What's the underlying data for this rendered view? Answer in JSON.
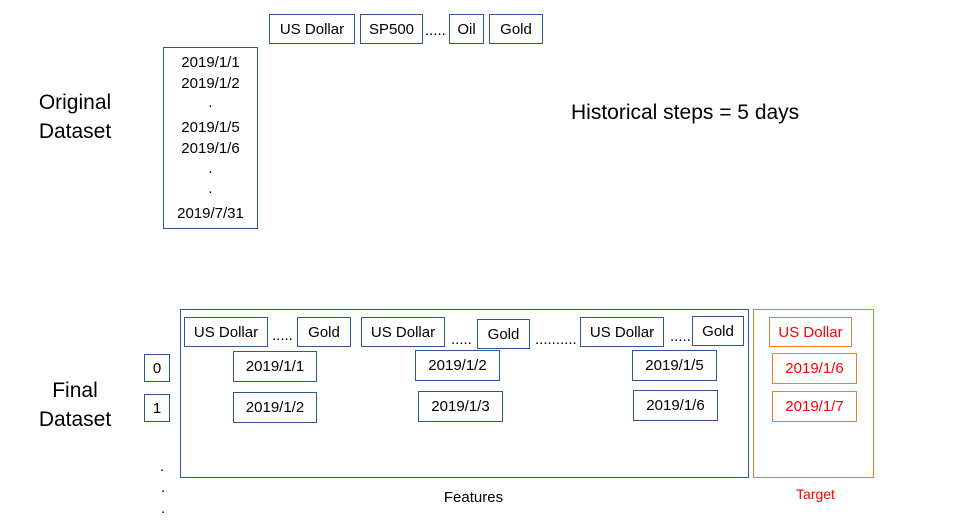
{
  "original": {
    "label_line1": "Original",
    "label_line2": "Dataset",
    "columns": [
      "US Dollar",
      "SP500",
      "Oil",
      "Gold"
    ],
    "column_ellipsis": ".....",
    "dates": [
      "2019/1/1",
      "2019/1/2",
      ".",
      "2019/1/5",
      "2019/1/6",
      ".",
      ".",
      "2019/7/31"
    ]
  },
  "historical_steps": "Historical steps = 5 days",
  "final": {
    "label_line1": "Final",
    "label_line2": "Dataset",
    "row_indices": [
      "0",
      "1"
    ],
    "row_dots": [
      ".",
      ".",
      "."
    ],
    "groups": [
      {
        "first": "US Dollar",
        "ellipsis": ".....",
        "last": "Gold",
        "dates": [
          "2019/1/1",
          "2019/1/2"
        ]
      },
      {
        "first": "US Dollar",
        "ellipsis": ".....",
        "last": "Gold",
        "dates": [
          "2019/1/2",
          "2019/1/3"
        ]
      },
      {
        "first": "US Dollar",
        "ellipsis": ".....",
        "last": "Gold",
        "dates": [
          "2019/1/5",
          "2019/1/6"
        ]
      }
    ],
    "group_ellipsis": "..........",
    "features_label": "Features",
    "target": {
      "column": "US Dollar",
      "dates": [
        "2019/1/6",
        "2019/1/7"
      ],
      "label": "Target"
    },
    "colors": {
      "box_border": "#2f5597",
      "target_border": "#ed7d31",
      "target_text": "#ff0000"
    }
  }
}
